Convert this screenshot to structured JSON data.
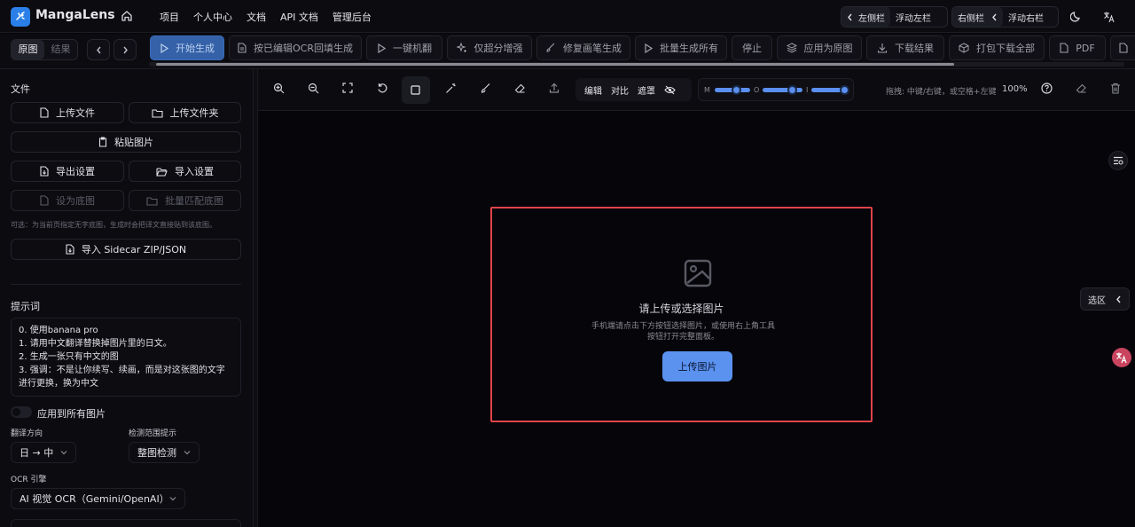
{
  "app": {
    "name": "MangaLens"
  },
  "nav": {
    "links": [
      "项目",
      "个人中心",
      "文档",
      "API 文档",
      "管理后台"
    ]
  },
  "sidebar_controls": {
    "left_sidebar": "左侧栏",
    "float_left": "浮动左栏",
    "right_sidebar": "右侧栏",
    "float_right": "浮动右栏"
  },
  "toolbar": {
    "view_toggle": {
      "original": "原图",
      "result": "结果"
    },
    "actions": [
      {
        "label": "开始生成",
        "icon": "play-icon"
      },
      {
        "label": "按已编辑OCR回填生成",
        "icon": "document-icon"
      },
      {
        "label": "一键机翻",
        "icon": "play-icon"
      },
      {
        "label": "仅超分增强",
        "icon": "sparkle-icon"
      },
      {
        "label": "修复画笔生成",
        "icon": "brush-icon"
      },
      {
        "label": "批量生成所有",
        "icon": "play-icon"
      },
      {
        "label": "停止",
        "icon": ""
      },
      {
        "label": "应用为原图",
        "icon": "layers-icon"
      },
      {
        "label": "下载结果",
        "icon": "download-icon"
      },
      {
        "label": "打包下载全部",
        "icon": "package-icon"
      },
      {
        "label": "PDF",
        "icon": "file-icon"
      }
    ]
  },
  "left_panel": {
    "files_title": "文件",
    "upload_file": "上传文件",
    "upload_folder": "上传文件夹",
    "paste_image": "粘贴图片",
    "export_settings": "导出设置",
    "import_settings": "导入设置",
    "set_base": "设为底图",
    "batch_match": "批量匹配底图",
    "hint": "可选：为当前页指定无字底图，生成时会把译文直接贴到该底图。",
    "import_sidecar": "导入 Sidecar ZIP/JSON",
    "prompt_title": "提示词",
    "prompt_lines": [
      "0. 使用banana pro",
      "1. 请用中文翻译替换掉图片里的日文。",
      "2. 生成一张只有中文的图",
      "3. 强调：不是让你续写、续画，而是对这张图的文字进行更换，换为中文"
    ],
    "apply_all": "应用到所有图片",
    "translate_dir_label": "翻译方向",
    "translate_dir_value": "日 → 中",
    "detect_range_label": "检测范围提示",
    "detect_range_value": "整图检测",
    "ocr_label": "OCR 引擎",
    "ocr_value": "AI 视觉 OCR（Gemini/OpenAI）"
  },
  "canvas": {
    "segment": [
      "编辑",
      "对比",
      "遮罩"
    ],
    "slider_labels": [
      "M",
      "O",
      "I"
    ],
    "sliders": [
      0.6,
      0.75,
      0.9
    ],
    "drag_hint": "拖拽: 中键/右键，或空格+左键",
    "zoom": "100%"
  },
  "dropzone": {
    "title": "请上传或选择图片",
    "desc": "手机端请点击下方按钮选择图片，或使用右上角工具按钮打开完整面板。",
    "button": "上传图片"
  },
  "right": {
    "select_label": "选区"
  },
  "colors": {
    "accent": "#5b92f0",
    "highlight": "#e0444a",
    "primary_btn": "#3461a8"
  }
}
